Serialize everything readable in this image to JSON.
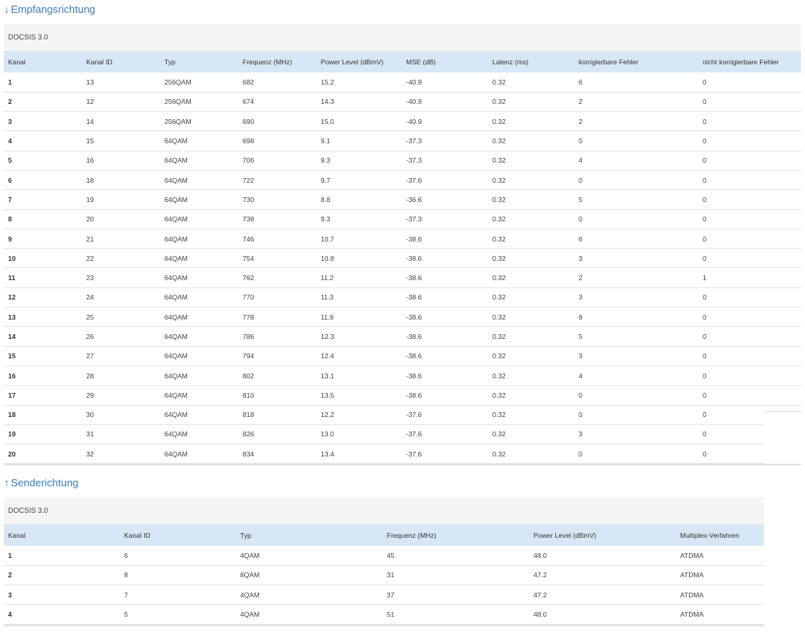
{
  "downstream": {
    "arrow": "↓",
    "title": "Empfangsrichtung",
    "card_title": "DOCSIS 3.0",
    "headers": [
      "Kanal",
      "Kanal ID",
      "Typ",
      "Frequenz (MHz)",
      "Power Level (dBmV)",
      "MSE (dB)",
      "Latenz (ms)",
      "korrigierbare Fehler",
      "nicht korrigierbare Fehler"
    ],
    "rows": [
      [
        "1",
        "13",
        "256QAM",
        "682",
        "15.2",
        "-40.9",
        "0.32",
        "6",
        "0"
      ],
      [
        "2",
        "12",
        "256QAM",
        "674",
        "14.3",
        "-40.9",
        "0.32",
        "2",
        "0"
      ],
      [
        "3",
        "14",
        "256QAM",
        "690",
        "15.0",
        "-40.9",
        "0.32",
        "2",
        "0"
      ],
      [
        "4",
        "15",
        "64QAM",
        "698",
        "9.1",
        "-37.3",
        "0.32",
        "0",
        "0"
      ],
      [
        "5",
        "16",
        "64QAM",
        "706",
        "9.3",
        "-37.3",
        "0.32",
        "4",
        "0"
      ],
      [
        "6",
        "18",
        "64QAM",
        "722",
        "9.7",
        "-37.6",
        "0.32",
        "0",
        "0"
      ],
      [
        "7",
        "19",
        "64QAM",
        "730",
        "8.8",
        "-36.6",
        "0.32",
        "5",
        "0"
      ],
      [
        "8",
        "20",
        "64QAM",
        "738",
        "9.3",
        "-37.3",
        "0.32",
        "0",
        "0"
      ],
      [
        "9",
        "21",
        "64QAM",
        "746",
        "10.7",
        "-38.6",
        "0.32",
        "6",
        "0"
      ],
      [
        "10",
        "22",
        "64QAM",
        "754",
        "10.8",
        "-38.6",
        "0.32",
        "3",
        "0"
      ],
      [
        "11",
        "23",
        "64QAM",
        "762",
        "11.2",
        "-38.6",
        "0.32",
        "2",
        "1"
      ],
      [
        "12",
        "24",
        "64QAM",
        "770",
        "11.3",
        "-38.6",
        "0.32",
        "3",
        "0"
      ],
      [
        "13",
        "25",
        "64QAM",
        "778",
        "11.9",
        "-38.6",
        "0.32",
        "9",
        "0"
      ],
      [
        "14",
        "26",
        "64QAM",
        "786",
        "12.3",
        "-38.6",
        "0.32",
        "5",
        "0"
      ],
      [
        "15",
        "27",
        "64QAM",
        "794",
        "12.4",
        "-38.6",
        "0.32",
        "3",
        "0"
      ],
      [
        "16",
        "28",
        "64QAM",
        "802",
        "13.1",
        "-38.6",
        "0.32",
        "4",
        "0"
      ],
      [
        "17",
        "29",
        "64QAM",
        "810",
        "13.5",
        "-38.6",
        "0.32",
        "0",
        "0"
      ],
      [
        "18",
        "30",
        "64QAM",
        "818",
        "12.2",
        "-37.6",
        "0.32",
        "0",
        "0"
      ],
      [
        "19",
        "31",
        "64QAM",
        "826",
        "13.0",
        "-37.6",
        "0.32",
        "3",
        "0"
      ],
      [
        "20",
        "32",
        "64QAM",
        "834",
        "13.4",
        "-37.6",
        "0.32",
        "0",
        "0"
      ]
    ]
  },
  "upstream": {
    "arrow": "↑",
    "title": "Senderichtung",
    "card_title": "DOCSIS 3.0",
    "headers": [
      "Kanal",
      "Kanal ID",
      "Typ",
      "Frequenz (MHz)",
      "Power Level (dBmV)",
      "Multiplex-Verfahren"
    ],
    "rows": [
      [
        "1",
        "6",
        "4QAM",
        "45",
        "48.0",
        "ATDMA"
      ],
      [
        "2",
        "8",
        "8QAM",
        "31",
        "47.2",
        "ATDMA"
      ],
      [
        "3",
        "7",
        "4QAM",
        "37",
        "47.2",
        "ATDMA"
      ],
      [
        "4",
        "5",
        "4QAM",
        "51",
        "48.0",
        "ATDMA"
      ]
    ]
  },
  "colors": {
    "accent": "#3a7fc0",
    "header_row_bg": "#d8e7f5",
    "card_head_bg": "#f5f5f3"
  }
}
